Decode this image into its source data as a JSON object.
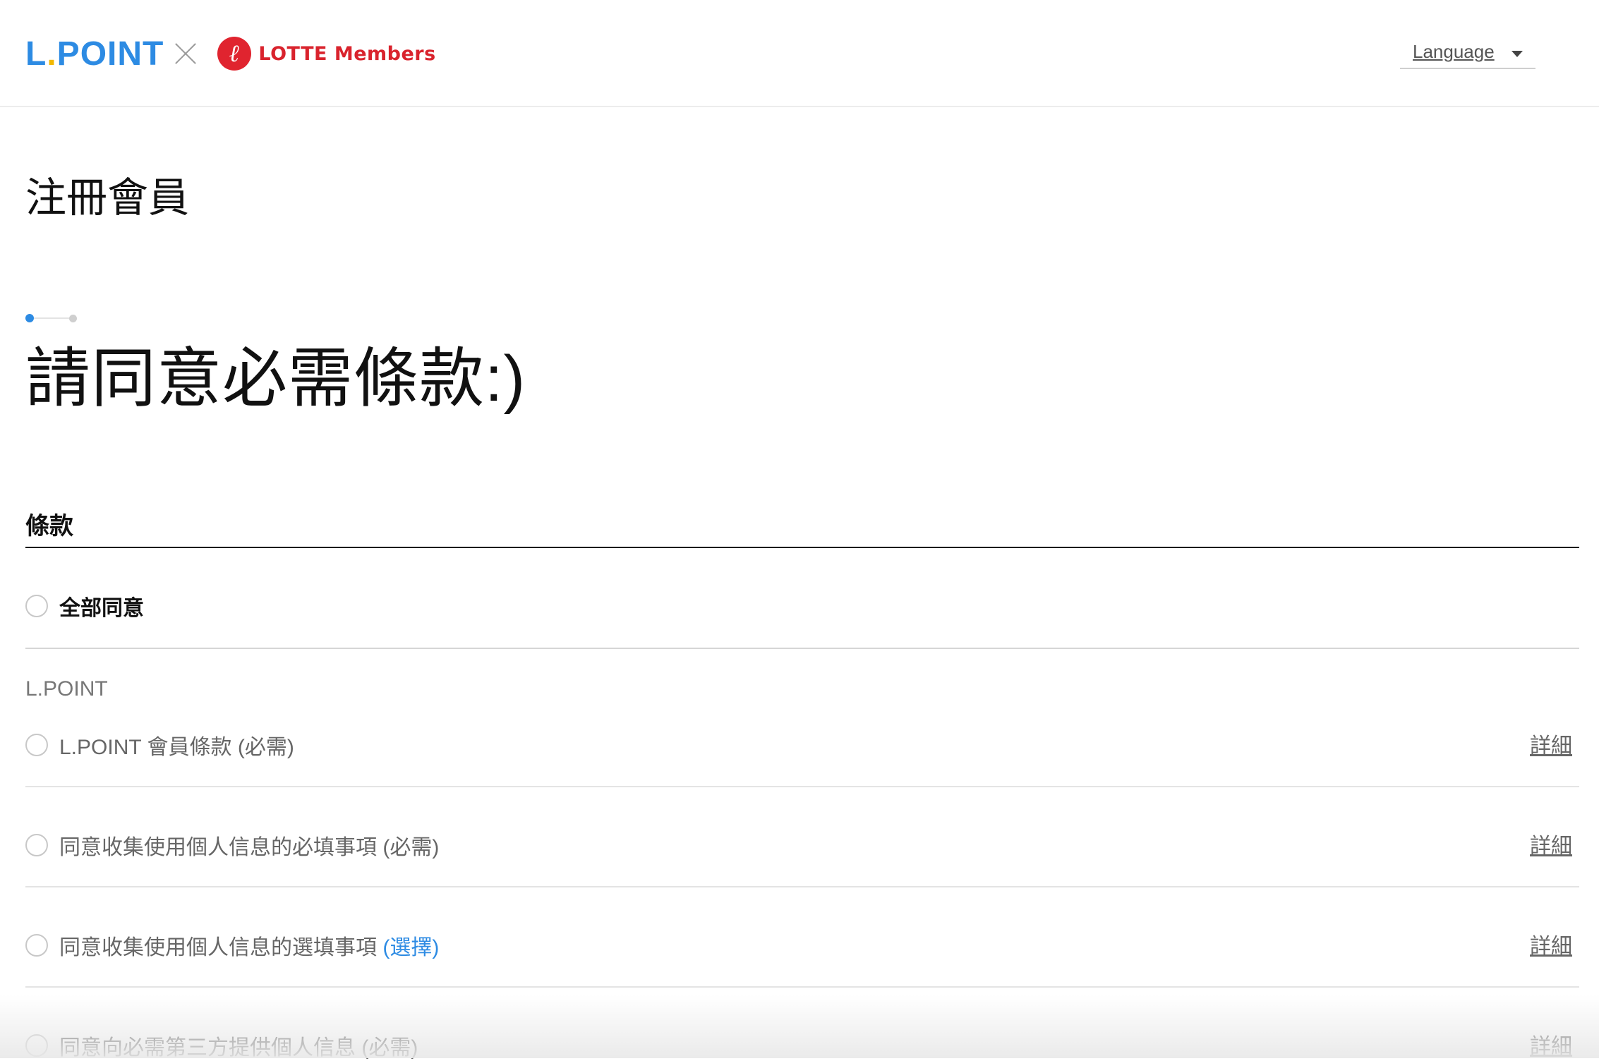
{
  "header": {
    "brand": {
      "lpoint_text_main": "L",
      "lpoint_dot": ".",
      "lpoint_text_rest": "POINT",
      "lotte_emblem": "ℓ",
      "lotte_text": "LOTTE Members"
    },
    "language_label": "Language"
  },
  "page_title": "注冊會員",
  "step": {
    "current": 1,
    "total": 2
  },
  "headline": "請同意必需條款:)",
  "terms": {
    "section_label": "條款",
    "agree_all_label": "全部同意",
    "group_label": "L.POINT",
    "items": [
      {
        "label": "L.POINT 會員條款",
        "tag": "(必需)",
        "tag_optional": false,
        "detail": "詳細"
      },
      {
        "label": "同意收集使用個人信息的必填事項",
        "tag": "(必需)",
        "tag_optional": false,
        "detail": "詳細"
      },
      {
        "label": "同意收集使用個人信息的選填事項",
        "tag": "(選擇)",
        "tag_optional": true,
        "detail": "詳細"
      },
      {
        "label": "同意向必需第三方提供個人信息",
        "tag": "(必需)",
        "tag_optional": false,
        "detail": "詳細"
      }
    ]
  },
  "colors": {
    "accent": "#2d8be3",
    "brand_red": "#e0242f",
    "lpoint_dot": "#f2b800"
  }
}
